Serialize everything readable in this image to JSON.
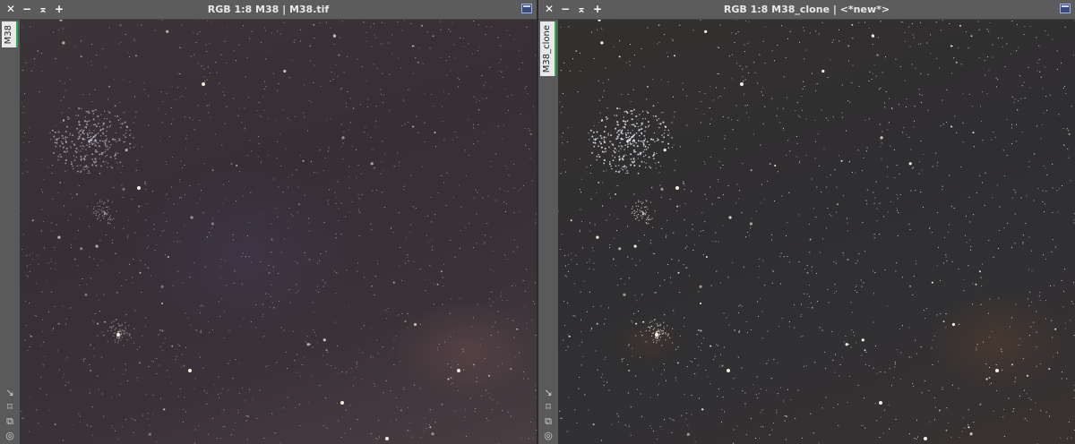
{
  "windows": [
    {
      "title": "RGB 1:8 M38 | M38.tif",
      "tab_label": "M38",
      "brightness": "dim"
    },
    {
      "title": "RGB 1:8 M38_clone | <*new*>",
      "tab_label": "M38_clone",
      "brightness": "bright"
    }
  ],
  "titlebar_buttons": {
    "close": "✕",
    "minimize": "−",
    "shade": "⌅",
    "add": "+"
  },
  "side_icons": [
    "↘",
    "⌑",
    "⧉",
    "◎"
  ],
  "colors": {
    "accent_tab": "#2fa84f",
    "titlebar": "#5c5c5c",
    "sidebar": "#5a5a5a"
  }
}
